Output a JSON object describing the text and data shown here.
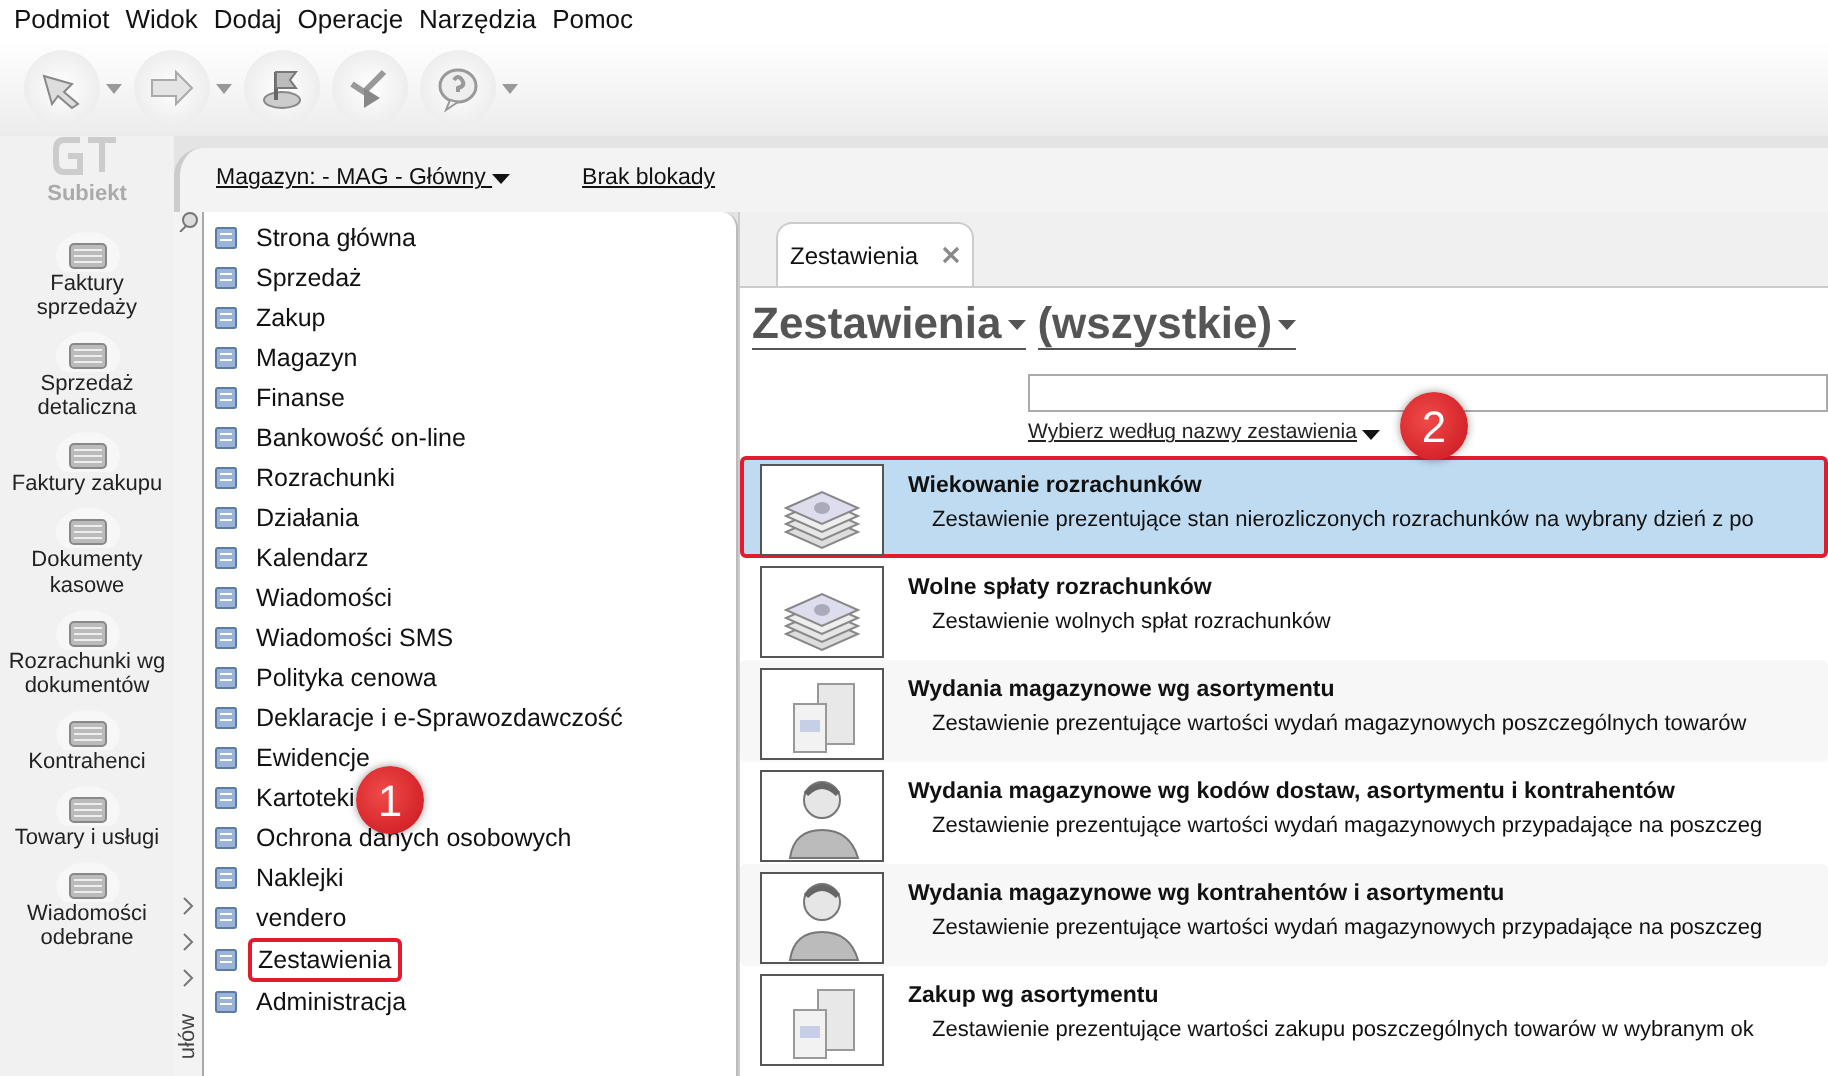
{
  "menu": [
    "Podmiot",
    "Widok",
    "Dodaj",
    "Operacje",
    "Narzędzia",
    "Pomoc"
  ],
  "toolbar": [
    {
      "menu": true
    },
    {
      "menu": true
    },
    {
      "menu": false
    },
    {
      "menu": false
    },
    {
      "menu": true
    }
  ],
  "sidebar": {
    "logo": "Subiekt",
    "items": [
      {
        "label": "Faktury sprzedaży"
      },
      {
        "label": "Sprzedaż detaliczna"
      },
      {
        "label": "Faktury zakupu"
      },
      {
        "label": "Dokumenty kasowe"
      },
      {
        "label": "Rozrachunki wg dokumentów"
      },
      {
        "label": "Kontrahenci"
      },
      {
        "label": "Towary i usługi"
      },
      {
        "label": "Wiadomości odebrane"
      }
    ]
  },
  "info_bar": {
    "warehouse": "Magazyn: - MAG - Główny",
    "lock": "Brak blokady"
  },
  "side_strip": {
    "label": "ułów"
  },
  "tree": [
    {
      "label": "Strona główna",
      "highlighted": false
    },
    {
      "label": "Sprzedaż",
      "highlighted": false
    },
    {
      "label": "Zakup",
      "highlighted": false
    },
    {
      "label": "Magazyn",
      "highlighted": false
    },
    {
      "label": "Finanse",
      "highlighted": false
    },
    {
      "label": "Bankowość on-line",
      "highlighted": false
    },
    {
      "label": "Rozrachunki",
      "highlighted": false
    },
    {
      "label": "Działania",
      "highlighted": false
    },
    {
      "label": "Kalendarz",
      "highlighted": false
    },
    {
      "label": "Wiadomości",
      "highlighted": false
    },
    {
      "label": "Wiadomości SMS",
      "highlighted": false
    },
    {
      "label": "Polityka cenowa",
      "highlighted": false
    },
    {
      "label": "Deklaracje i e-Sprawozdawczość",
      "highlighted": false
    },
    {
      "label": "Ewidencje",
      "highlighted": false
    },
    {
      "label": "Kartoteki",
      "highlighted": false
    },
    {
      "label": "Ochrona danych osobowych",
      "highlighted": false
    },
    {
      "label": "Naklejki",
      "highlighted": false
    },
    {
      "label": "vendero",
      "highlighted": false
    },
    {
      "label": "Zestawienia",
      "highlighted": true
    },
    {
      "label": "Administracja",
      "highlighted": false
    }
  ],
  "tab": {
    "label": "Zestawienia",
    "selected": true
  },
  "heading": {
    "category": "Zestawienia",
    "filter": "(wszystkie)"
  },
  "search": {
    "mode": "Wybierz według nazwy zestawienia"
  },
  "reports": [
    {
      "kind": "money",
      "title": "Wiekowanie rozrachunków",
      "description": "Zestawienie prezentujące stan nierozliczonych rozrachunków na wybrany dzień z po",
      "selected": true
    },
    {
      "kind": "money",
      "title": "Wolne spłaty rozrachunków",
      "description": "Zestawienie wolnych spłat rozrachunków",
      "selected": false
    },
    {
      "kind": "boxes",
      "title": "Wydania magazynowe wg asortymentu",
      "description": "Zestawienie prezentujące wartości wydań magazynowych poszczególnych towarów",
      "selected": false
    },
    {
      "kind": "person",
      "title": "Wydania magazynowe wg kodów dostaw, asortymentu i kontrahentów",
      "description": "Zestawienie prezentujące wartości wydań magazynowych przypadające na poszczeg",
      "selected": false
    },
    {
      "kind": "person",
      "title": "Wydania magazynowe wg kontrahentów i asortymentu",
      "description": "Zestawienie prezentujące wartości wydań magazynowych przypadające na poszczeg",
      "selected": false
    },
    {
      "kind": "boxes",
      "title": "Zakup wg asortymentu",
      "description": "Zestawienie prezentujące wartości zakupu poszczególnych towarów w wybranym ok",
      "selected": false
    }
  ],
  "callouts": [
    {
      "number": "1"
    },
    {
      "number": "2"
    }
  ]
}
